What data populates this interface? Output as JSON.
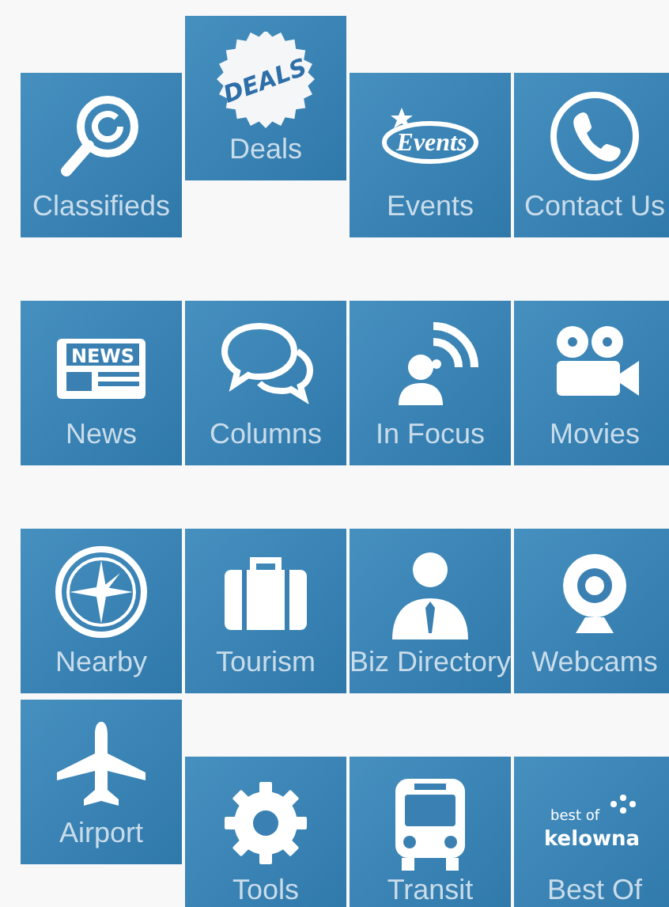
{
  "rows": [
    {
      "tiles": [
        {
          "label": "Classifieds",
          "raised": false
        },
        {
          "label": "Deals",
          "raised": true,
          "icon_texts": [
            "DEALS"
          ]
        },
        {
          "label": "Events",
          "raised": false,
          "icon_texts": [
            "Events"
          ]
        },
        {
          "label": "Contact Us",
          "raised": false
        }
      ]
    },
    {
      "tiles": [
        {
          "label": "News",
          "raised": false,
          "icon_texts": [
            "NEWS"
          ]
        },
        {
          "label": "Columns",
          "raised": false
        },
        {
          "label": "In Focus",
          "raised": false
        },
        {
          "label": "Movies",
          "raised": false
        }
      ]
    },
    {
      "tiles": [
        {
          "label": "Nearby",
          "raised": false
        },
        {
          "label": "Tourism",
          "raised": false
        },
        {
          "label": "Biz Directory",
          "raised": false
        },
        {
          "label": "Webcams",
          "raised": false
        }
      ]
    },
    {
      "tiles": [
        {
          "label": "Airport",
          "raised": true
        },
        {
          "label": "Tools",
          "raised": false
        },
        {
          "label": "Transit",
          "raised": false
        },
        {
          "label": "Best Of",
          "raised": false,
          "icon_texts": [
            "best of",
            "kelowna"
          ]
        }
      ]
    }
  ]
}
